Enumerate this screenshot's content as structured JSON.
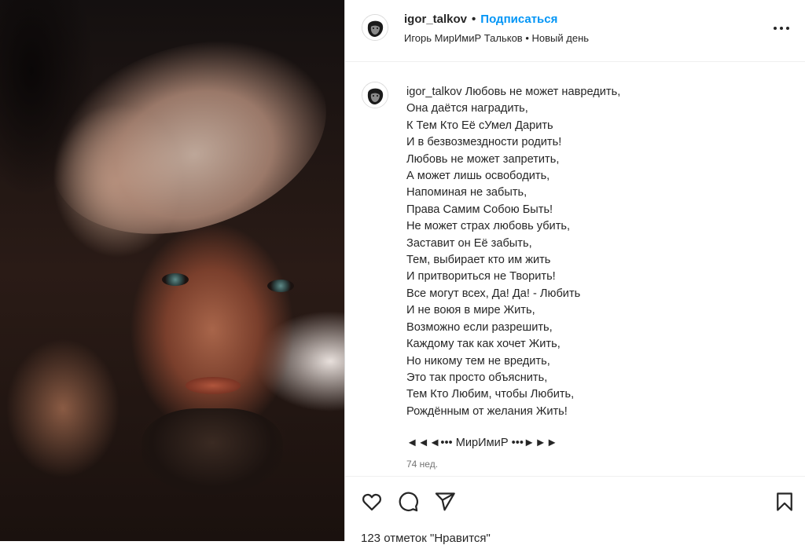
{
  "post": {
    "username": "igor_talkov",
    "separator": "•",
    "follow_label": "Подписаться",
    "subtitle_name": "Игорь МирИмиР Тальков",
    "subtitle_sep": "•",
    "subtitle_audio": "Новый день",
    "more_icon": "more-horizontal-icon"
  },
  "caption": {
    "username": "igor_talkov",
    "first_line": "Любовь не может навредить,",
    "lines": [
      "Она даётся наградить,",
      "К Тем Кто Её сУмел Дарить",
      "И в безвозмездности родить!",
      "Любовь не может запретить,",
      "А может лишь освободить,",
      "Напоминая не забыть,",
      "Права Самим Собою Быть!",
      "Не может страх любовь убить,",
      "Заставит он Её забыть,",
      "Тем, выбирает кто им жить",
      "И притвориться не Творить!",
      "Все могут всех, Да! Да! - Любить",
      "И не воюя в мире Жить,",
      "Возможно если разрешить,",
      "Каждому так как хочет Жить,",
      "Но никому тем не вредить,",
      "Это так просто объяснить,",
      "Тем Кто Любим, чтобы Любить,",
      "Рождённым от желания Жить!"
    ],
    "signature": "◄◄◄••• МирИмиР •••►►►",
    "time": "74 нед."
  },
  "actions": {
    "like_icon": "heart-icon",
    "comment_icon": "comment-icon",
    "share_icon": "send-icon",
    "save_icon": "bookmark-icon"
  },
  "likes_text": "123 отметок \"Нравится\""
}
